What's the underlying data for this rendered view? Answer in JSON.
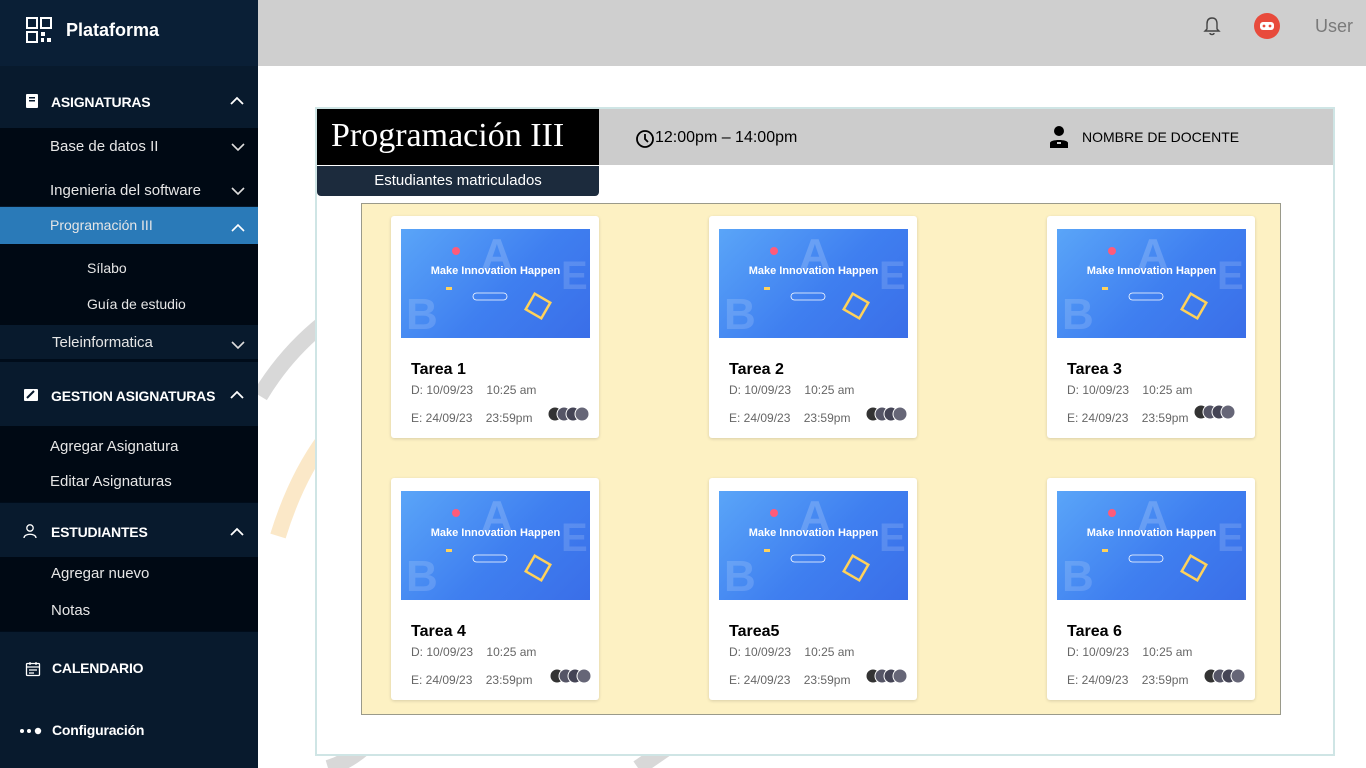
{
  "brand": {
    "title": "Plataforma"
  },
  "sidebar": {
    "asignaturas": {
      "title": "ASIGNATURAS",
      "items": [
        {
          "label": "Base de datos II"
        },
        {
          "label": "Ingenieria del software"
        },
        {
          "label": "Programación III"
        },
        {
          "label": "Teleinformatica"
        }
      ],
      "subitems": [
        {
          "label": "Sílabo"
        },
        {
          "label": "Guía de estudio"
        }
      ]
    },
    "gestion": {
      "title": "GESTION ASIGNATURAS",
      "items": [
        {
          "label": "Agregar Asignatura"
        },
        {
          "label": "Editar Asignaturas"
        }
      ]
    },
    "estudiantes": {
      "title": "ESTUDIANTES",
      "items": [
        {
          "label": "Agregar nuevo"
        },
        {
          "label": "Notas"
        }
      ]
    },
    "calendario": {
      "title": "CALENDARIO"
    },
    "configuracion": {
      "title": "Configuración"
    }
  },
  "header": {
    "user": "User"
  },
  "course": {
    "title": "Programación III",
    "time": "12:00pm – 14:00pm",
    "teacher": "NOMBRE DE DOCENTE",
    "enrolled_tab": "Estudiantes matriculados"
  },
  "thumbnail_text": "Make Innovation Happen",
  "tasks": [
    {
      "title": "Tarea 1",
      "d_date": "D: 10/09/23",
      "d_time": "10:25 am",
      "e_date": "E: 24/09/23",
      "e_time": "23:59pm"
    },
    {
      "title": "Tarea 2",
      "d_date": "D: 10/09/23",
      "d_time": "10:25 am",
      "e_date": "E: 24/09/23",
      "e_time": "23:59pm"
    },
    {
      "title": "Tarea 3",
      "d_date": "D: 10/09/23",
      "d_time": "10:25 am",
      "e_date": "E: 24/09/23",
      "e_time": "23:59pm"
    },
    {
      "title": "Tarea 4",
      "d_date": "D: 10/09/23",
      "d_time": "10:25 am",
      "e_date": "E: 24/09/23",
      "e_time": "23:59pm"
    },
    {
      "title": "Tarea5",
      "d_date": "D: 10/09/23",
      "d_time": "10:25 am",
      "e_date": "E: 24/09/23",
      "e_time": "23:59pm"
    },
    {
      "title": "Tarea 6",
      "d_date": "D: 10/09/23",
      "d_time": "10:25 am",
      "e_date": "E: 24/09/23",
      "e_time": "23:59pm"
    }
  ],
  "colors": {
    "sidebar_bg": "#000c1a",
    "active_item": "#2a7ab8",
    "tasks_bg": "#fdf1c3",
    "avatar": "#e84b3c"
  }
}
